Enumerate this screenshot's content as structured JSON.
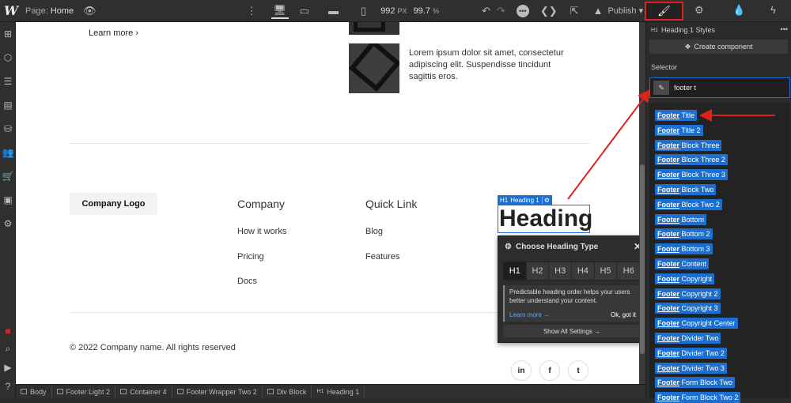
{
  "topbar": {
    "logo": "W",
    "page_prefix": "Page:",
    "page_name": "Home",
    "width_value": "992",
    "width_unit": "PX",
    "zoom": "99.7",
    "zoom_unit": "%",
    "publish_label": "Publish",
    "icons": [
      "eye-icon",
      "more-vertical-icon",
      "desktop-icon",
      "tablet-landscape-icon",
      "tablet-icon",
      "phone-icon",
      "undo-icon",
      "redo-icon",
      "more-circle-icon",
      "code-icon",
      "export-icon",
      "publish-icon",
      "brush-icon",
      "gear-icon",
      "drops-icon",
      "lightning-icon"
    ]
  },
  "canvas": {
    "learn_more": "Learn more",
    "lorem": "Lorem ipsum dolor sit amet, consectetur adipiscing elit. Suspendisse tincidunt sagittis eros.",
    "company_logo": "Company Logo",
    "col1": {
      "title": "Company",
      "links": [
        "How it works",
        "Pricing",
        "Docs"
      ]
    },
    "col2": {
      "title": "Quick Link",
      "links": [
        "Blog",
        "Features"
      ]
    },
    "heading_tag_label": "Heading 1",
    "heading_tag_prefix": "H1",
    "heading_text": "Heading",
    "copyright": "© 2022 Company name. All rights reserved",
    "social": [
      "in",
      "f",
      "t"
    ]
  },
  "heading_popup": {
    "title": "Choose Heading Type",
    "tabs": [
      "H1",
      "H2",
      "H3",
      "H4",
      "H5",
      "H6"
    ],
    "active_tab": "H1",
    "info": "Predictable heading order helps your users better understand your content.",
    "learn_more": "Learn more →",
    "ok": "Ok, got it",
    "show_all": "Show All Settings →"
  },
  "panel": {
    "element_prefix": "H1",
    "element_title": "Heading 1 Styles",
    "create_component": "Create component",
    "selector_label": "Selector",
    "selector_value": "footer t",
    "suggestions": [
      {
        "bold": "Footer",
        "rest": " Title"
      },
      {
        "bold": "Footer",
        "rest": " Title 2"
      },
      {
        "bold": "Footer",
        "rest": " Block Three"
      },
      {
        "bold": "Footer",
        "rest": " Block Three 2"
      },
      {
        "bold": "Footer",
        "rest": " Block Three 3"
      },
      {
        "bold": "Footer",
        "rest": " Block Two"
      },
      {
        "bold": "Footer",
        "rest": " Block Two 2"
      },
      {
        "bold": "Footer",
        "rest": " Bottom"
      },
      {
        "bold": "Footer",
        "rest": " Bottom 2"
      },
      {
        "bold": "Footer",
        "rest": " Bottom 3"
      },
      {
        "bold": "Footer",
        "rest": " Content"
      },
      {
        "bold": "Footer",
        "rest": " Copyright"
      },
      {
        "bold": "Footer",
        "rest": " Copyright 2"
      },
      {
        "bold": "Footer",
        "rest": " Copyright 3"
      },
      {
        "bold": "Footer",
        "rest": " Copyright Center"
      },
      {
        "bold": "Footer",
        "rest": " Divider Two"
      },
      {
        "bold": "Footer",
        "rest": " Divider Two 2"
      },
      {
        "bold": "Footer",
        "rest": " Divider Two 3"
      },
      {
        "bold": "Footer",
        "rest": " Form Block Two"
      },
      {
        "bold": "Footer",
        "rest": " Form Block Two 2"
      }
    ]
  },
  "breadcrumbs": [
    "Body",
    "Footer Light 2",
    "Container 4",
    "Footer Wrapper Two 2",
    "Div Block",
    "Heading 1"
  ],
  "colors": {
    "accent": "#1b6fd1",
    "annotation": "#e0201c"
  }
}
